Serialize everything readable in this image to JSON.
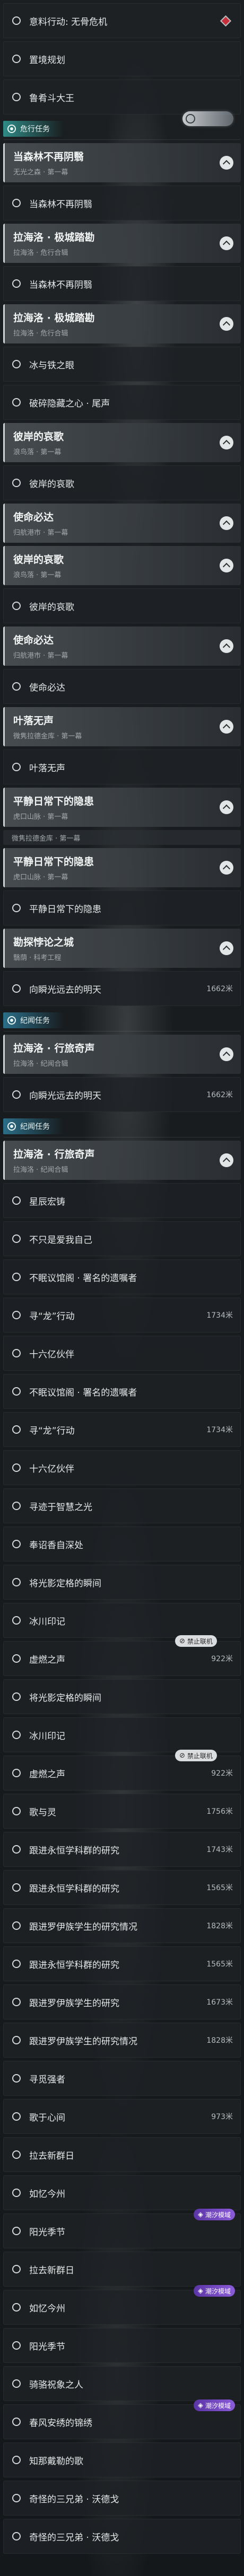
{
  "theme": {
    "danger": "#c4303b",
    "purple_a": "#5b34a6",
    "purple_b": "#8a5bd8",
    "section_teal": "#2f8a86",
    "section_blue": "#2b6e88"
  },
  "icons": {
    "item": "quest-ring-icon",
    "group_toggle": "chevron-up-icon",
    "section": "compass-icon"
  },
  "rows": [
    {
      "type": "item",
      "title": "意料行动: 无骨危机",
      "marker": "diamond-icon"
    },
    {
      "type": "item",
      "title": "置境规划"
    },
    {
      "type": "item",
      "title": "鲁肴斗大王"
    },
    {
      "type": "section",
      "label": "危行任务",
      "color": "#2f8a86",
      "emblem": "game-emblem-icon"
    },
    {
      "type": "group",
      "title": "当森林不再阴翳",
      "subtitle": "无光之森 · 第一幕"
    },
    {
      "type": "item",
      "title": "当森林不再阴翳"
    },
    {
      "type": "group",
      "title": "拉海洛 · 极城踏勘",
      "subtitle": "拉海洛 · 危行合辑"
    },
    {
      "type": "item",
      "title": "当森林不再阴翳"
    },
    {
      "type": "group",
      "title": "拉海洛 · 极城踏勘",
      "subtitle": "拉海洛 · 危行合辑"
    },
    {
      "type": "item",
      "title": "冰与铁之眼"
    },
    {
      "type": "item",
      "title": "破碎隐藏之心 · 尾声"
    },
    {
      "type": "group",
      "title": "彼岸的哀歌",
      "subtitle": "浪鸟落 · 第一幕"
    },
    {
      "type": "item",
      "title": "彼岸的哀歌"
    },
    {
      "type": "group",
      "title": "使命必达",
      "subtitle": "归航港市 · 第一幕"
    },
    {
      "type": "group",
      "title": "彼岸的哀歌",
      "subtitle": "浪鸟落 · 第一幕"
    },
    {
      "type": "item",
      "title": "彼岸的哀歌"
    },
    {
      "type": "group",
      "title": "使命必达",
      "subtitle": "归航港市 · 第一幕"
    },
    {
      "type": "item",
      "title": "使命必达"
    },
    {
      "type": "group",
      "title": "叶落无声",
      "subtitle": "微隽拉德金库 · 第一幕"
    },
    {
      "type": "item",
      "title": "叶落无声"
    },
    {
      "type": "group",
      "title": "平静日常下的隐患",
      "subtitle": "虎口山脉 · 第一幕"
    },
    {
      "type": "strip",
      "title": "微隽拉德金库 · 第一幕"
    },
    {
      "type": "group",
      "title": "平静日常下的隐患",
      "subtitle": "虎口山脉 · 第一幕"
    },
    {
      "type": "item",
      "title": "平静日常下的隐患"
    },
    {
      "type": "group",
      "title": "勘探悖论之城",
      "subtitle": "翳荫 · 科考工程"
    },
    {
      "type": "item",
      "title": "向瞬光远去的明天",
      "distance": "1662米"
    },
    {
      "type": "section",
      "label": "纪闻任务",
      "color": "#2b6e88"
    },
    {
      "type": "group",
      "title": "拉海洛 · 行旅奇声",
      "subtitle": "拉海洛 · 纪闻合辑"
    },
    {
      "type": "item",
      "title": "向瞬光远去的明天",
      "distance": "1662米"
    },
    {
      "type": "section",
      "label": "纪闻任务",
      "color": "#2b6e88"
    },
    {
      "type": "group",
      "title": "拉海洛 · 行旅奇声",
      "subtitle": "拉海洛 · 纪闻合辑"
    },
    {
      "type": "item",
      "title": "星辰宏铸"
    },
    {
      "type": "item",
      "title": "不只是爱我自己"
    },
    {
      "type": "item",
      "title": "不眠议馆阁 · 署名的遗嘱者"
    },
    {
      "type": "item",
      "title": "寻“龙”行动",
      "distance": "1734米"
    },
    {
      "type": "item",
      "title": "十六亿伙伴"
    },
    {
      "type": "item",
      "title": "不眠议馆阁 · 署名的遗嘱者"
    },
    {
      "type": "item",
      "title": "寻“龙”行动",
      "distance": "1734米"
    },
    {
      "type": "item",
      "title": "十六亿伙伴"
    },
    {
      "type": "item",
      "title": "寻迹于智慧之光"
    },
    {
      "type": "item",
      "title": "奉诏香自深处"
    },
    {
      "type": "item",
      "title": "将光影定格的瞬间"
    },
    {
      "type": "item",
      "title": "冰川印记"
    },
    {
      "type": "item",
      "title": "虚燃之声",
      "distance": "922米",
      "badge": {
        "text": "禁止联机",
        "icon": "no-coop-icon",
        "style": "light"
      }
    },
    {
      "type": "item",
      "title": "将光影定格的瞬间"
    },
    {
      "type": "item",
      "title": "冰川印记"
    },
    {
      "type": "item",
      "title": "虚燃之声",
      "distance": "922米",
      "badge": {
        "text": "禁止联机",
        "icon": "no-coop-icon",
        "style": "light"
      }
    },
    {
      "type": "item",
      "title": "歌与灵",
      "distance": "1756米"
    },
    {
      "type": "item",
      "title": "跟进永恒学科群的研究",
      "distance": "1743米"
    },
    {
      "type": "item",
      "title": "跟进永恒学科群的研究",
      "distance": "1565米"
    },
    {
      "type": "item",
      "title": "跟进罗伊族学生的研究情况",
      "distance": "1828米"
    },
    {
      "type": "item",
      "title": "跟进永恒学科群的研究",
      "distance": "1565米"
    },
    {
      "type": "item",
      "title": "跟进罗伊族学生的研究",
      "distance": "1673米"
    },
    {
      "type": "item",
      "title": "跟进罗伊族学生的研究情况",
      "distance": "1828米"
    },
    {
      "type": "item",
      "title": "寻觅强者"
    },
    {
      "type": "item",
      "title": "歌于心间",
      "distance": "973米"
    },
    {
      "type": "item",
      "title": "拉去新群日"
    },
    {
      "type": "item",
      "title": "如忆今州"
    },
    {
      "type": "item",
      "title": "阳光季节",
      "badge": {
        "text": "潮汐模域",
        "icon": "tide-icon",
        "style": "purple"
      }
    },
    {
      "type": "item",
      "title": "拉去新群日"
    },
    {
      "type": "item",
      "title": "如忆今州",
      "badge": {
        "text": "潮汐模域",
        "icon": "tide-icon",
        "style": "purple"
      }
    },
    {
      "type": "item",
      "title": "阳光季节"
    },
    {
      "type": "item",
      "title": "骑骆祝象之人"
    },
    {
      "type": "item",
      "title": "春风安绣的锦绣",
      "badge": {
        "text": "潮汐模域",
        "icon": "tide-icon",
        "style": "purple"
      }
    },
    {
      "type": "item",
      "title": "知那戴勒的歌"
    },
    {
      "type": "item",
      "title": "奇怪的三兄弟 · 沃德戈"
    },
    {
      "type": "item",
      "title": "奇怪的三兄弟 · 沃德戈"
    }
  ]
}
